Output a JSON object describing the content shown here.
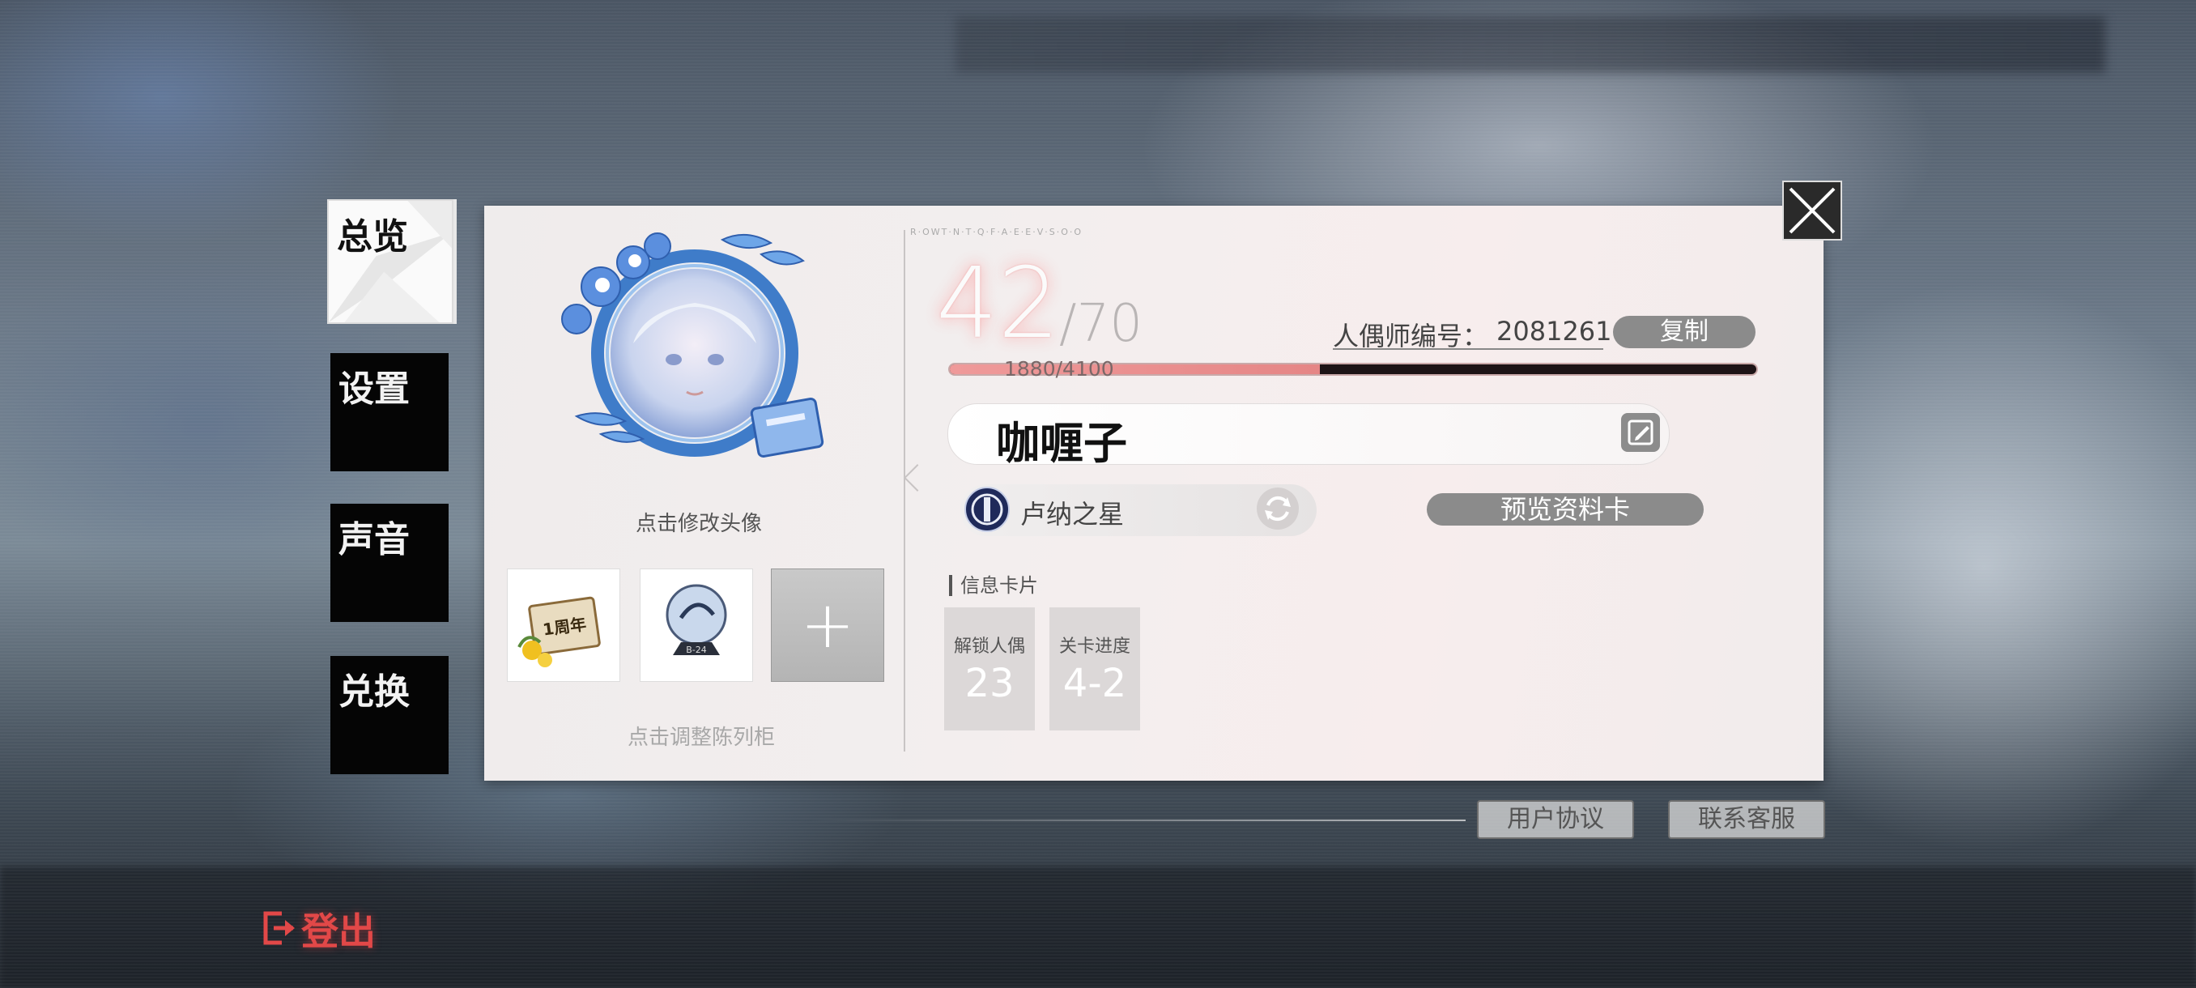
{
  "window": {
    "close_icon": "close-icon"
  },
  "sidebar": {
    "items": [
      {
        "label": "总览",
        "active": true
      },
      {
        "label": "设置",
        "active": false
      },
      {
        "label": "声音",
        "active": false
      },
      {
        "label": "兑换",
        "active": false
      }
    ]
  },
  "profile": {
    "avatar_caption": "点击修改头像",
    "cabinet_caption": "点击调整陈列柜",
    "badges": [
      {
        "name": "1周年",
        "icon": "anniversary-badge-icon"
      },
      {
        "name": "B-24",
        "icon": "crystal-orb-badge-icon"
      },
      {
        "name": "+",
        "icon": "plus-icon"
      }
    ],
    "serial_code": "R·OWT·N·T·Q·F·A·E·E·V·S·O·O",
    "level": "42",
    "level_max": "/70",
    "id_label": "人偶师编号：",
    "id_value": "2081261",
    "copy_label": "复制",
    "xp_text": "1880/4100",
    "xp_fraction": 0.4585,
    "name": "咖喱子",
    "faction_name": "卢纳之星",
    "faction_icon": "luna-star-emblem-icon",
    "switch_icon": "refresh-icon",
    "edit_icon": "edit-icon",
    "preview_label": "预览资料卡",
    "info_title": "信息卡片",
    "stats": [
      {
        "label": "解锁人偶",
        "value": "23"
      },
      {
        "label": "关卡进度",
        "value": "4-2"
      }
    ]
  },
  "footer": {
    "user_agreement": "用户协议",
    "contact_support": "联系客服",
    "logout": "登出",
    "logout_icon": "logout-icon"
  },
  "colors": {
    "accent_red": "#e24848",
    "xp_fill": "#ef9a9a",
    "button_grey": "#8b8b8b",
    "panel_bg": "#f1eded"
  }
}
